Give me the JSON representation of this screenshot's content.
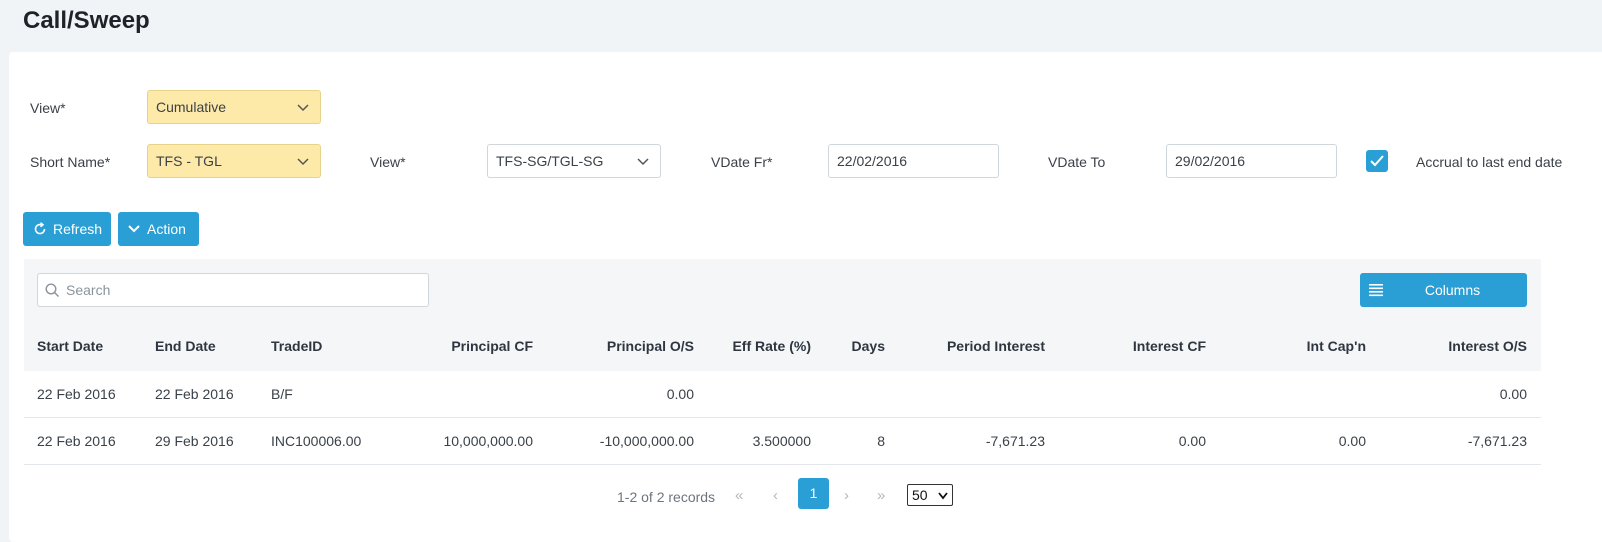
{
  "page": {
    "title": "Call/Sweep"
  },
  "filters": {
    "view1": {
      "label": "View*",
      "value": "Cumulative"
    },
    "short_name": {
      "label": "Short Name*",
      "value": "TFS - TGL"
    },
    "view2": {
      "label": "View*",
      "value": "TFS-SG/TGL-SG"
    },
    "vdate_fr": {
      "label": "VDate Fr*",
      "value": "22/02/2016"
    },
    "vdate_to": {
      "label": "VDate To",
      "value": "29/02/2016"
    },
    "accrual": {
      "label": "Accrual to last end date",
      "checked": true
    }
  },
  "actions": {
    "refresh": "Refresh",
    "action": "Action"
  },
  "table": {
    "search_placeholder": "Search",
    "columns_button": "Columns",
    "headers": [
      "Start Date",
      "End Date",
      "TradeID",
      "Principal CF",
      "Principal O/S",
      "Eff Rate (%)",
      "Days",
      "Period Interest",
      "Interest CF",
      "Int Cap'n",
      "Interest O/S"
    ],
    "rows": [
      [
        "22 Feb 2016",
        "22 Feb 2016",
        "B/F",
        "",
        "0.00",
        "",
        "",
        "",
        "",
        "",
        "0.00"
      ],
      [
        "22 Feb 2016",
        "29 Feb 2016",
        "INC100006.00",
        "10,000,000.00",
        "-10,000,000.00",
        "3.500000",
        "8",
        "-7,671.23",
        "0.00",
        "0.00",
        "-7,671.23"
      ]
    ]
  },
  "pagination": {
    "info": "1-2 of 2 records",
    "current_page": "1",
    "page_size": "50",
    "page_size_options": [
      "50"
    ]
  },
  "colors": {
    "accent": "#2a9fd6",
    "required_field": "#fde9a8"
  }
}
